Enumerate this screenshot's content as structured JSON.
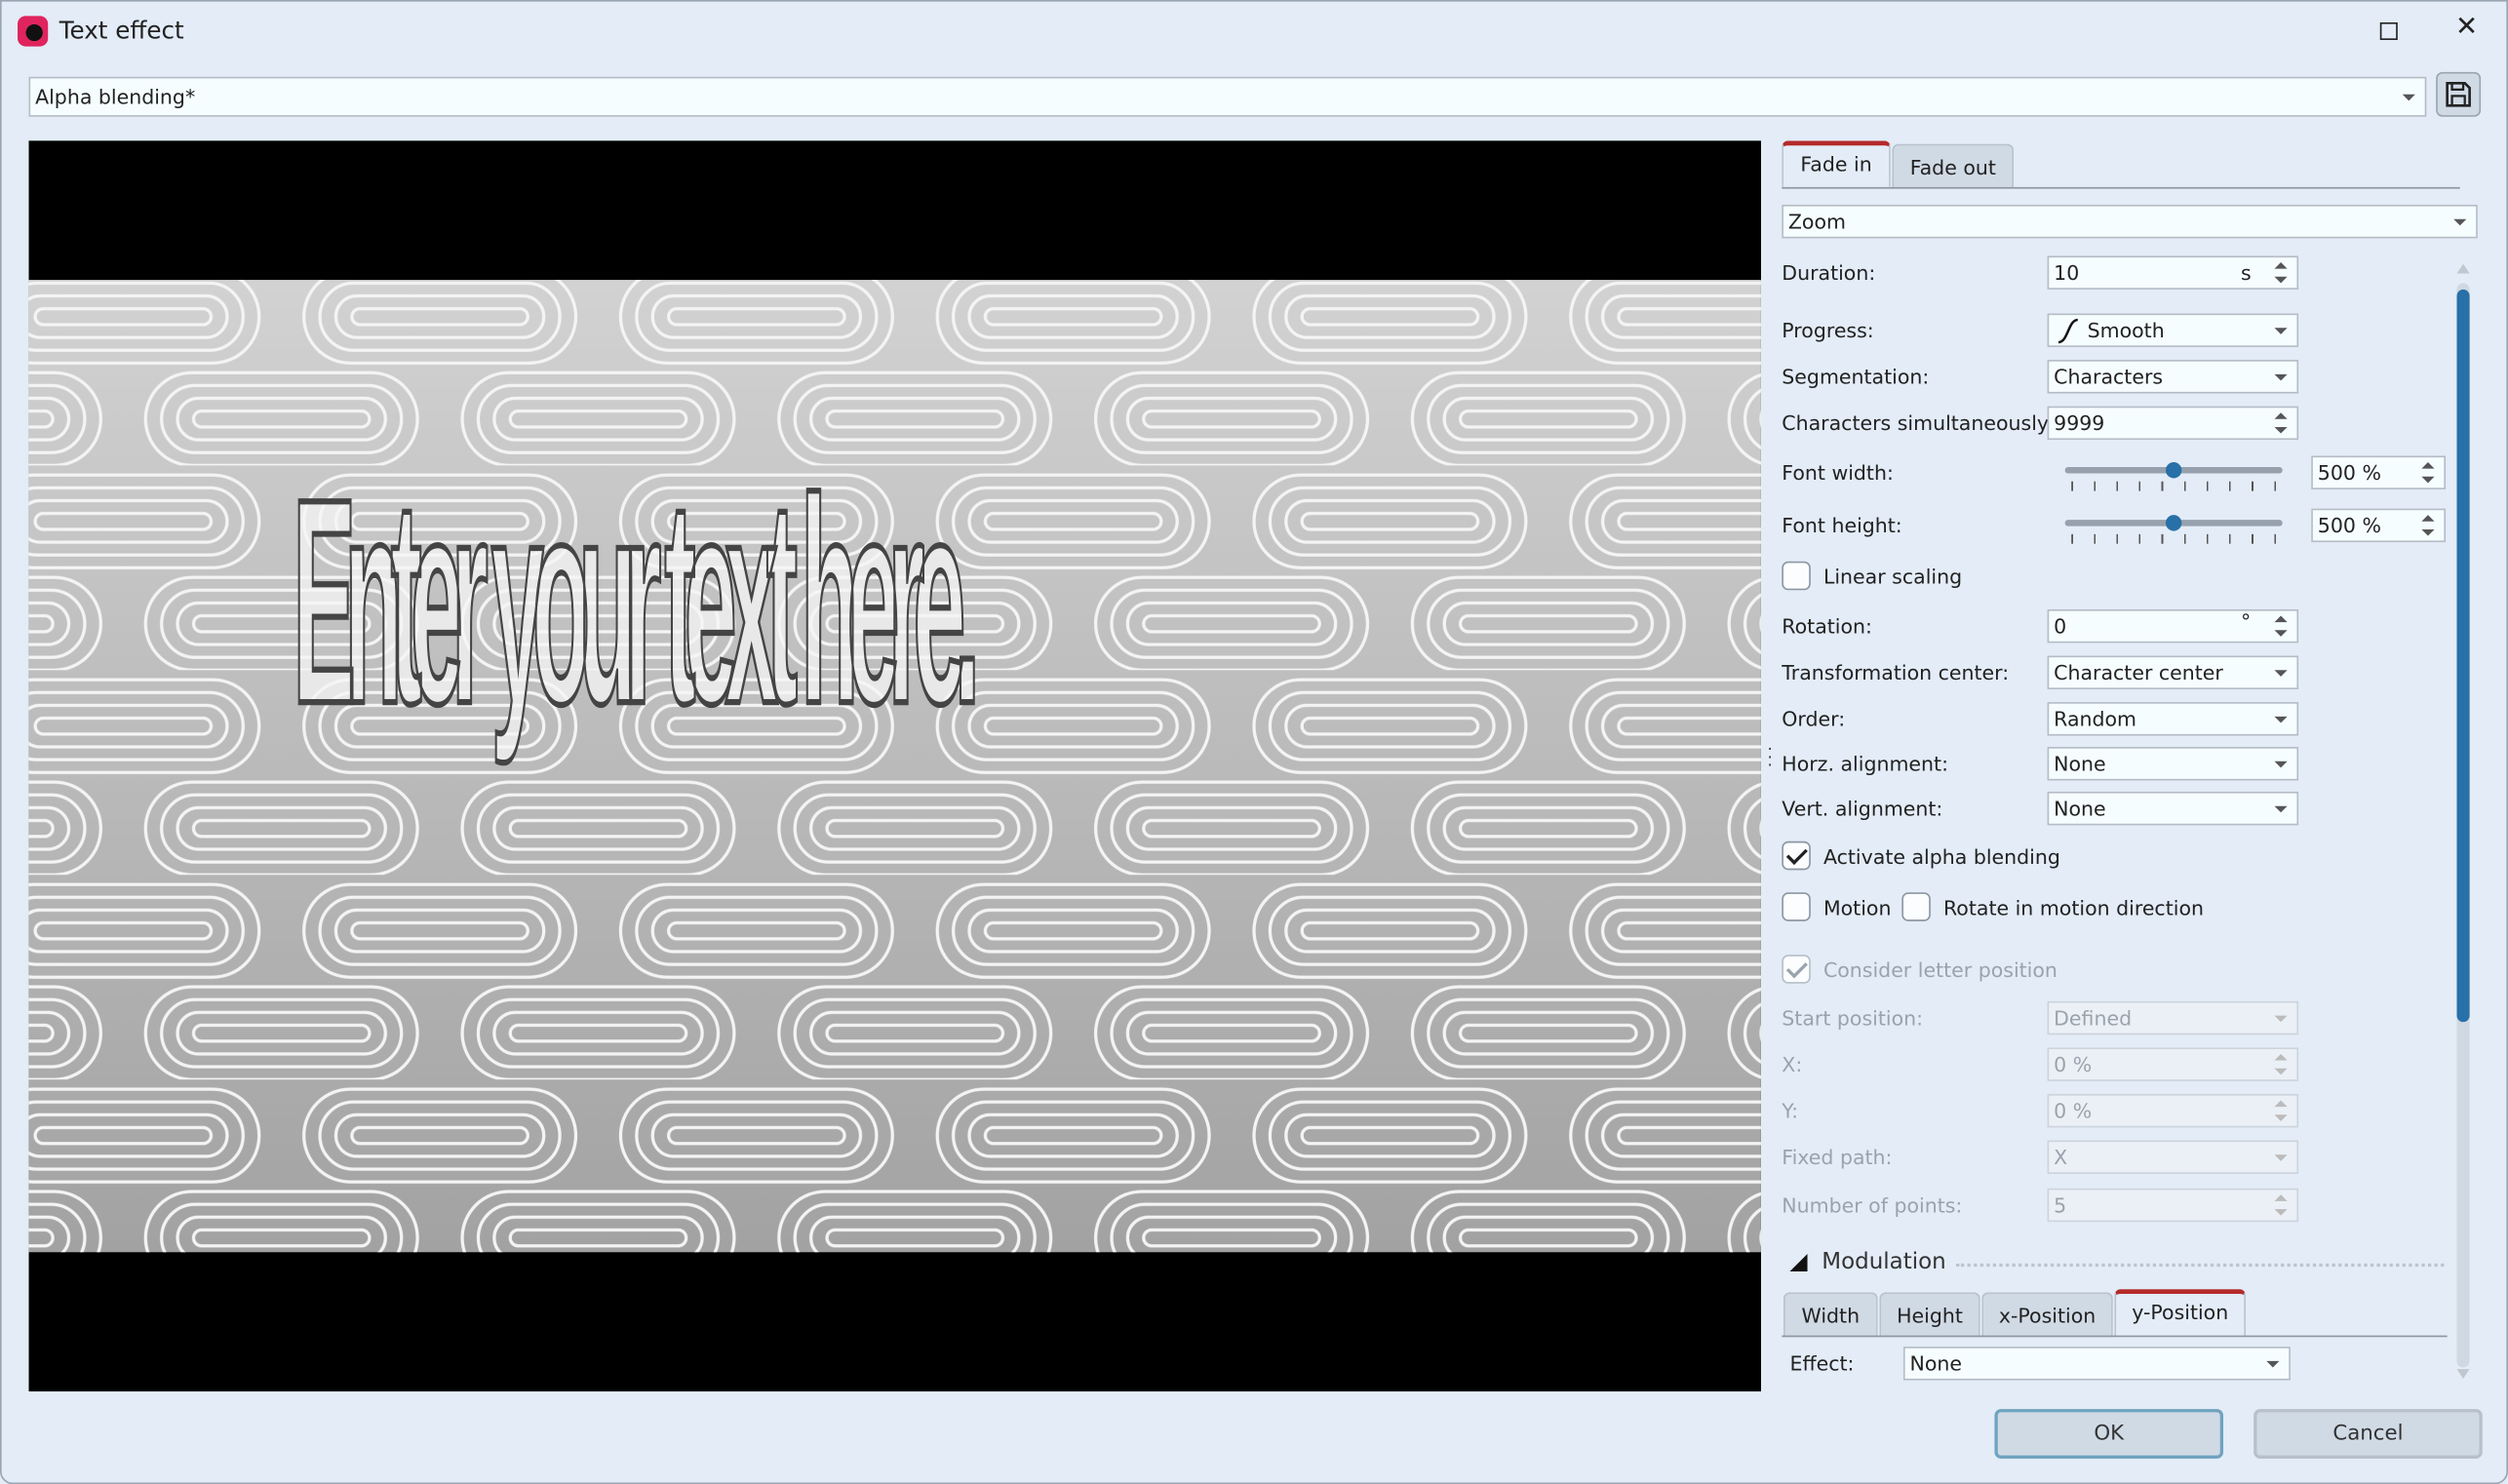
{
  "window": {
    "title": "Text effect",
    "icon": "app-icon",
    "maximize_icon": "maximize-icon",
    "close_icon": "close-icon"
  },
  "preset": {
    "value": "Alpha blending*",
    "save_icon": "save-icon"
  },
  "preview": {
    "text": "Enter your text here."
  },
  "tabs": [
    {
      "label": "Fade in",
      "active": true
    },
    {
      "label": "Fade out",
      "active": false
    }
  ],
  "effect_type": "Zoom",
  "fields": {
    "duration": {
      "label": "Duration:",
      "value": "10",
      "unit": "s"
    },
    "progress": {
      "label": "Progress:",
      "value": "Smooth"
    },
    "segmentation": {
      "label": "Segmentation:",
      "value": "Characters"
    },
    "chars_sim": {
      "label": "Characters simultaneously:",
      "value": "9999"
    },
    "font_width": {
      "label": "Font width:",
      "value": "500 %",
      "slider_fraction": 0.5
    },
    "font_height": {
      "label": "Font height:",
      "value": "500 %",
      "slider_fraction": 0.5
    },
    "linear_scaling": {
      "label": "Linear scaling",
      "checked": false
    },
    "rotation": {
      "label": "Rotation:",
      "value": "0",
      "unit": "°"
    },
    "transform_center": {
      "label": "Transformation center:",
      "value": "Character center"
    },
    "order": {
      "label": "Order:",
      "value": "Random"
    },
    "horz_align": {
      "label": "Horz. alignment:",
      "value": "None"
    },
    "vert_align": {
      "label": "Vert. alignment:",
      "value": "None"
    },
    "alpha_blending": {
      "label": "Activate alpha blending",
      "checked": true
    },
    "motion": {
      "label": "Motion",
      "checked": false
    },
    "rotate_motion": {
      "label": "Rotate in motion direction",
      "checked": false
    },
    "consider_letter": {
      "label": "Consider letter position",
      "checked": true,
      "disabled": true
    },
    "start_position": {
      "label": "Start position:",
      "value": "Defined"
    },
    "x": {
      "label": "X:",
      "value": "0 %"
    },
    "y": {
      "label": "Y:",
      "value": "0 %"
    },
    "fixed_path": {
      "label": "Fixed path:",
      "value": "X"
    },
    "num_points": {
      "label": "Number of points:",
      "value": "5"
    }
  },
  "modulation": {
    "title": "Modulation",
    "tabs": [
      {
        "label": "Width"
      },
      {
        "label": "Height"
      },
      {
        "label": "x-Position"
      },
      {
        "label": "y-Position",
        "active": true
      }
    ],
    "effect_label": "Effect:",
    "effect_value": "None"
  },
  "buttons": {
    "ok": "OK",
    "cancel": "Cancel"
  },
  "colors": {
    "accent_tab": "#b52a2a",
    "scroll_thumb": "#2870a8",
    "background": "#e3ecf7"
  }
}
